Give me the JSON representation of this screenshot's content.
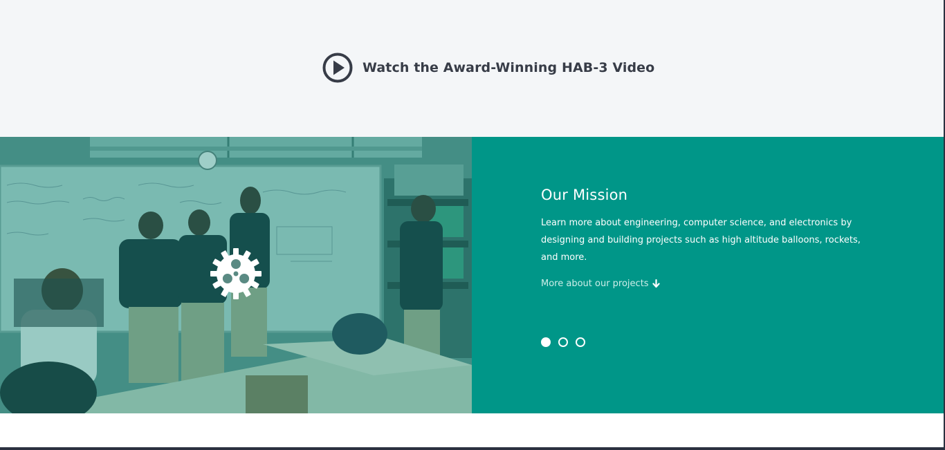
{
  "video": {
    "icon": "play-circle-icon",
    "label": "Watch the Award-Winning HAB-3 Video"
  },
  "photo": {
    "description_icon": "gear-icon",
    "overlay_color": "#00897b"
  },
  "mission": {
    "title": "Our Mission",
    "text": "Learn more about engineering, computer science, and electronics by designing and building projects such as high altitude balloons, rockets, and more.",
    "link_label": "More about our projects",
    "link_icon": "arrow-down-icon",
    "background": "#009688"
  },
  "carousel": {
    "slides": 3,
    "active_index": 0
  }
}
